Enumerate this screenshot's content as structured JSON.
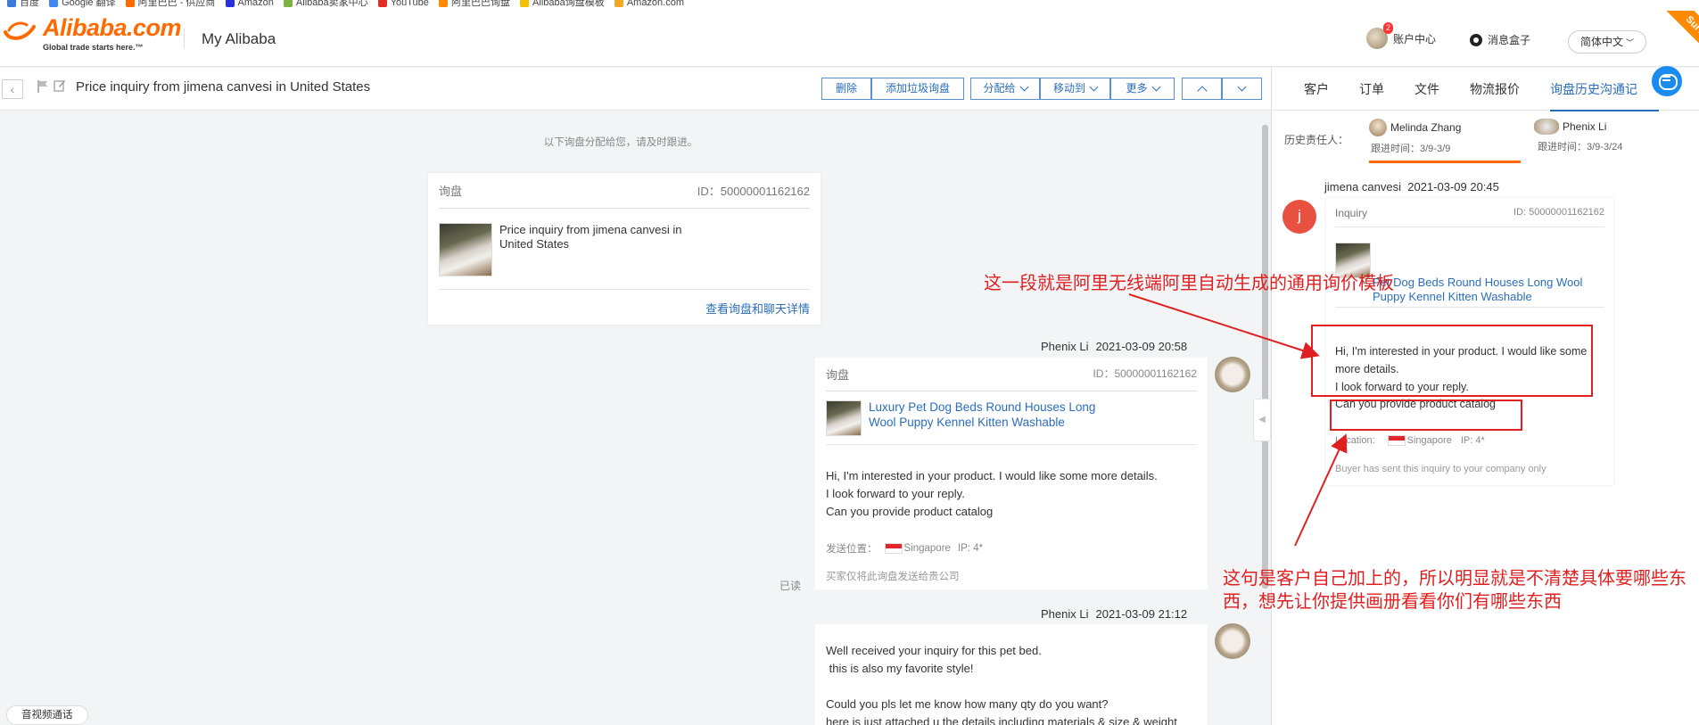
{
  "bookmarks": [
    "百度",
    "Google 翻译",
    "阿里巴巴 - 供应商",
    "Amazon",
    "Alibaba卖家中心",
    "YouTube",
    "阿里巴巴询盘",
    "Alibaba询盘模板",
    "Amazon.com"
  ],
  "header": {
    "brand": "Alibaba.com",
    "tagline": "Global trade starts here.™",
    "title": "My Alibaba",
    "account_label": "账户中心",
    "account_badge": "2",
    "messages_label": "消息盒子",
    "language": "简体中文",
    "survey": "Survey"
  },
  "toolbar": {
    "subject": "Price inquiry from jimena canvesi in United States",
    "delete": "删除",
    "add_spam": "添加垃圾询盘",
    "assign": "分配给",
    "move": "移动到",
    "more": "更多"
  },
  "right_panel": {
    "tabs": [
      "客户",
      "订单",
      "文件",
      "物流报价",
      "询盘历史沟通记"
    ],
    "history_label": "历史责任人：",
    "history": [
      {
        "name": "Melinda Zhang",
        "time": "跟进时间：3/9-3/9"
      },
      {
        "name": "Phenix Li",
        "time": "跟进时间：3/9-3/24"
      }
    ],
    "sender": "jimena canvesi",
    "sender_time": "2021-03-09 20:45",
    "avatar_letter": "j",
    "card": {
      "label": "Inquiry",
      "id": "ID: 50000001162162",
      "product": "Pet Dog Beds Round Houses Long Wool Puppy Kennel Kitten Washable",
      "body_1": "Hi, I'm interested in your product. I would like some more details.",
      "body_2": "I look forward to your reply.",
      "body_3": "Can you provide product catalog",
      "location_label": "Location:",
      "country": "Singapore",
      "ip": "IP: 4*",
      "footer": "Buyer has sent this inquiry to your company only"
    }
  },
  "main": {
    "assign_note": "以下询盘分配给您，请及时跟进。",
    "card1": {
      "label": "询盘",
      "id": "ID：50000001162162",
      "title": "Price inquiry from jimena canvesi in United States",
      "link": "查看询盘和聊天详情"
    },
    "msg1": {
      "sender": "Phenix Li",
      "time": "2021-03-09 20:58",
      "label": "询盘",
      "id": "ID：50000001162162",
      "product": "Luxury Pet Dog Beds Round Houses Long Wool Puppy Kennel Kitten Washable",
      "body_1": "Hi, I'm interested in your product. I would like some more details.",
      "body_2": "I look forward to your reply.",
      "body_3": "Can you provide product catalog",
      "location_label": "发送位置：",
      "country": "Singapore",
      "ip": "IP: 4*",
      "footer": "买家仅将此询盘发送给贵公司",
      "read": "已读"
    },
    "msg2": {
      "sender": "Phenix Li",
      "time": "2021-03-09 21:12",
      "body": "Well received your inquiry for this pet bed.\n this is also my favorite style!\n\nCould you pls let me know how many qty do you want?\nhere is just attached u the details including materials & size & weight"
    },
    "video_call": "音视频通话"
  },
  "annotations": {
    "top": "这一段就是阿里无线端阿里自动生成的通用询价模板",
    "bottom_1": "这句是客户自己加上的，所以明显就是不清楚具体要哪些东",
    "bottom_2": "西，想先让你提供画册看看你们有哪些东西"
  },
  "colors": {
    "brand": "#ff6a00",
    "link": "#2a6ebb",
    "annotation": "#e02020"
  }
}
